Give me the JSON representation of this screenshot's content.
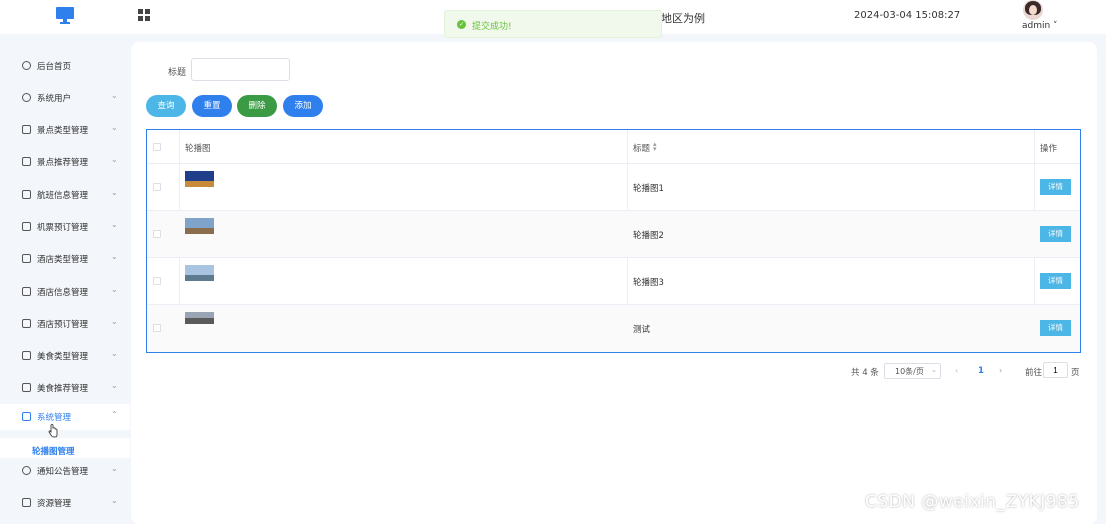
{
  "header": {
    "title": "地区为例",
    "datetime": "2024-03-04 15:08:27",
    "user": "admin ˅"
  },
  "toast": {
    "message": "提交成功!",
    "icon": "success-check-icon",
    "color": "#67c23a"
  },
  "sidebar": {
    "items": [
      {
        "label": "后台首页",
        "icon": "clock-icon"
      },
      {
        "label": "系统用户",
        "icon": "user-icon"
      },
      {
        "label": "景点类型管理",
        "icon": "list-icon"
      },
      {
        "label": "景点推荐管理",
        "icon": "list-icon"
      },
      {
        "label": "航班信息管理",
        "icon": "list-icon"
      },
      {
        "label": "机票预订管理",
        "icon": "list-icon"
      },
      {
        "label": "酒店类型管理",
        "icon": "list-icon"
      },
      {
        "label": "酒店信息管理",
        "icon": "list-icon"
      },
      {
        "label": "酒店预订管理",
        "icon": "list-icon"
      },
      {
        "label": "美食类型管理",
        "icon": "list-icon"
      },
      {
        "label": "美食推荐管理",
        "icon": "list-icon"
      },
      {
        "label": "系统管理",
        "icon": "folder-icon",
        "active": true
      },
      {
        "label": "通知公告管理",
        "icon": "sparkle-icon"
      },
      {
        "label": "资源管理",
        "icon": "box-icon"
      }
    ],
    "submenu_label": "轮播图管理",
    "accent": "#2f80ed"
  },
  "search": {
    "label": "标题",
    "value": "",
    "placeholder": ""
  },
  "buttons": {
    "query": "查询",
    "reset": "重置",
    "delete": "删除",
    "add": "添加"
  },
  "table": {
    "columns": [
      "轮播图",
      "标题",
      "操作"
    ],
    "rows": [
      {
        "title": "轮播图1",
        "action": "详情"
      },
      {
        "title": "轮播图2",
        "action": "详情"
      },
      {
        "title": "轮播图3",
        "action": "详情"
      },
      {
        "title": "测试",
        "action": "详情"
      }
    ]
  },
  "pagination": {
    "total": "共 4 条",
    "page_size": "10条/页",
    "current_page": "1",
    "goto_label": "前往",
    "goto_value": "1",
    "page_unit": "页"
  },
  "watermark": "CSDN @weixin_ZYKJ985",
  "colors": {
    "primary": "#2f80ed",
    "info": "#4cb6e6",
    "danger": "#3b9b45"
  }
}
